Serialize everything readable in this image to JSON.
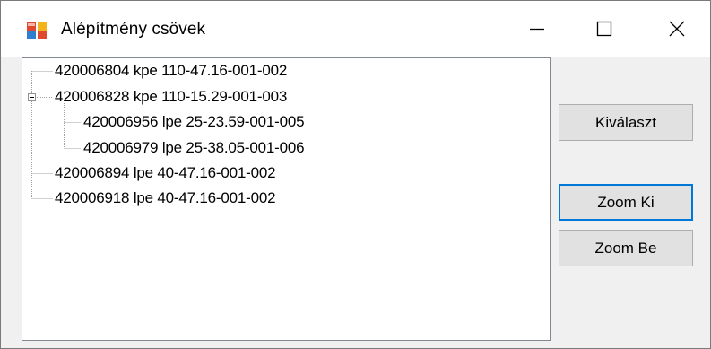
{
  "window": {
    "title": "Alépítmény csövek"
  },
  "controls": {
    "minimize_icon": "minimize-icon",
    "maximize_icon": "maximize-icon",
    "close_icon": "close-icon"
  },
  "tree": {
    "nodes": [
      {
        "label": "420006804 kpe 110-47.16-001-002"
      },
      {
        "label": "420006828 kpe 110-15.29-001-003",
        "expanded": true
      },
      {
        "label": "420006956 lpe 25-23.59-001-005"
      },
      {
        "label": "420006979 lpe 25-38.05-001-006"
      },
      {
        "label": "420006894 lpe 40-47.16-001-002"
      },
      {
        "label": "420006918 lpe 40-47.16-001-002"
      }
    ]
  },
  "buttons": {
    "select": "Kiválaszt",
    "zoom_out": "Zoom Ki",
    "zoom_in": "Zoom Be"
  },
  "colors": {
    "accent": "#0078d7",
    "button_face": "#e1e1e1",
    "window_bg": "#f0f0f0"
  }
}
